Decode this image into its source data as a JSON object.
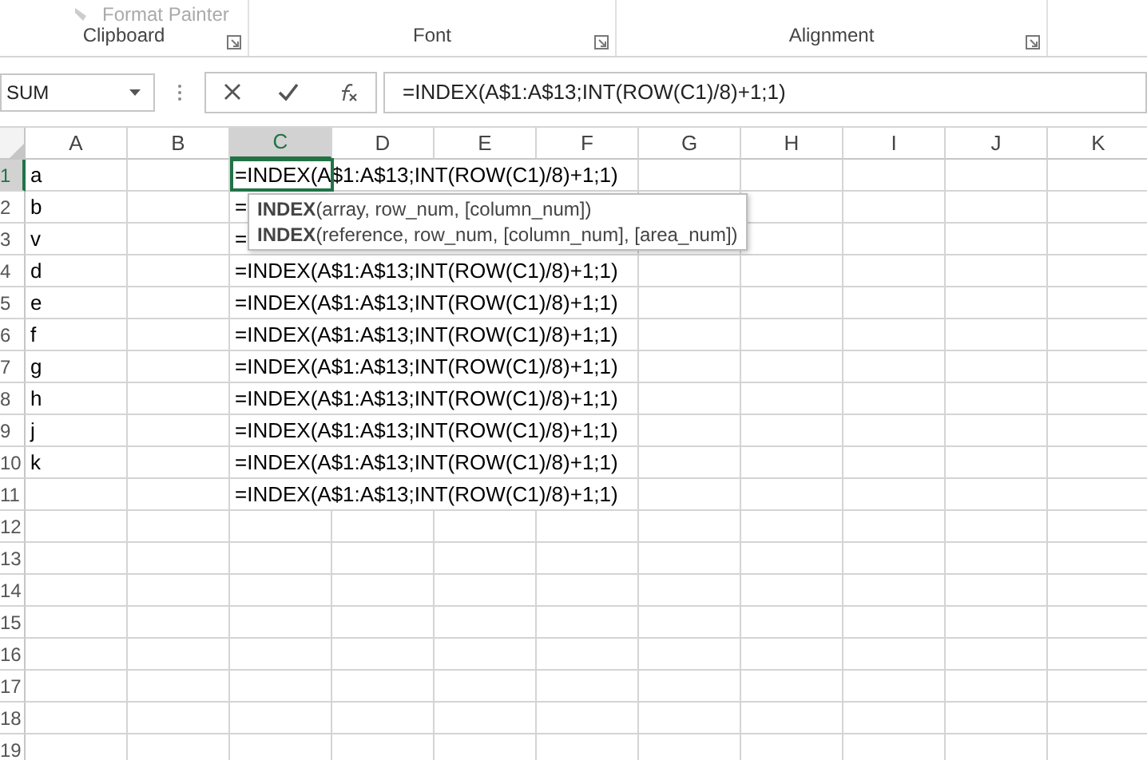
{
  "ribbon": {
    "partial_button": {
      "label": "Format Painter",
      "disabled": true
    },
    "groups": [
      {
        "label": "Clipboard"
      },
      {
        "label": "Font"
      },
      {
        "label": "Alignment"
      }
    ]
  },
  "formula_bar": {
    "name_box": "SUM",
    "formula": "=INDEX(A$1:A$13;INT(ROW(C1)/8)+1;1)"
  },
  "columns": [
    {
      "label": "A",
      "selected": false
    },
    {
      "label": "B",
      "selected": false
    },
    {
      "label": "C",
      "selected": true
    },
    {
      "label": "D",
      "selected": false
    },
    {
      "label": "E",
      "selected": false
    },
    {
      "label": "F",
      "selected": false
    },
    {
      "label": "G",
      "selected": false
    },
    {
      "label": "H",
      "selected": false
    },
    {
      "label": "I",
      "selected": false
    },
    {
      "label": "J",
      "selected": false
    },
    {
      "label": "K",
      "selected": false
    }
  ],
  "rows": [
    {
      "number": "1",
      "selected": true,
      "col_a": "a",
      "col_c": "=INDEX(A$1:A$13;INT(ROW(C1)/8)+1;1)"
    },
    {
      "number": "2",
      "selected": false,
      "col_a": "b",
      "col_c": "="
    },
    {
      "number": "3",
      "selected": false,
      "col_a": "v",
      "col_c": "="
    },
    {
      "number": "4",
      "selected": false,
      "col_a": "d",
      "col_c": "=INDEX(A$1:A$13;INT(ROW(C1)/8)+1;1)"
    },
    {
      "number": "5",
      "selected": false,
      "col_a": "e",
      "col_c": "=INDEX(A$1:A$13;INT(ROW(C1)/8)+1;1)"
    },
    {
      "number": "6",
      "selected": false,
      "col_a": "f",
      "col_c": "=INDEX(A$1:A$13;INT(ROW(C1)/8)+1;1)"
    },
    {
      "number": "7",
      "selected": false,
      "col_a": "g",
      "col_c": "=INDEX(A$1:A$13;INT(ROW(C1)/8)+1;1)"
    },
    {
      "number": "8",
      "selected": false,
      "col_a": "h",
      "col_c": "=INDEX(A$1:A$13;INT(ROW(C1)/8)+1;1)"
    },
    {
      "number": "9",
      "selected": false,
      "col_a": "j",
      "col_c": "=INDEX(A$1:A$13;INT(ROW(C1)/8)+1;1)"
    },
    {
      "number": "10",
      "selected": false,
      "col_a": "k",
      "col_c": "=INDEX(A$1:A$13;INT(ROW(C1)/8)+1;1)"
    },
    {
      "number": "11",
      "selected": false,
      "col_c": "=INDEX(A$1:A$13;INT(ROW(C1)/8)+1;1)"
    },
    {
      "number": "12",
      "selected": false
    },
    {
      "number": "13",
      "selected": false
    },
    {
      "number": "14",
      "selected": false
    },
    {
      "number": "15",
      "selected": false
    },
    {
      "number": "16",
      "selected": false
    },
    {
      "number": "17",
      "selected": false
    },
    {
      "number": "18",
      "selected": false
    },
    {
      "number": "19",
      "selected": false
    }
  ],
  "tooltip": {
    "lines": [
      "**INDEX**(array, row_num, [column_num])",
      "**INDEX**(reference, row_num, [column_num], [area_num])"
    ]
  }
}
